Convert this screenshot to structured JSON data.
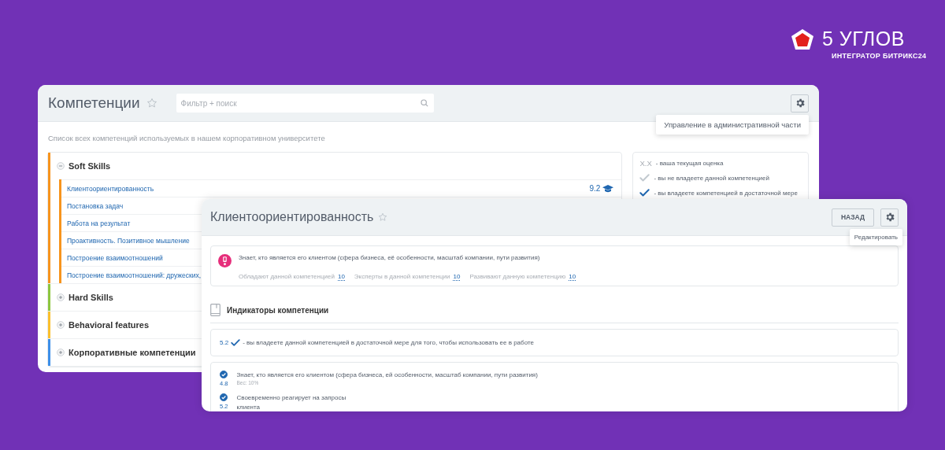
{
  "logo": {
    "name": "5 УГЛОВ",
    "tagline": "ИНТЕГРАТОР БИТРИКС24"
  },
  "catalog_window": {
    "title": "Компетенции",
    "search": {
      "placeholder": "Фильтр + поиск"
    },
    "settings_tooltip": "Управление в административной части",
    "description": "Список всех компетенций используемых в нашем корпоративном университете",
    "groups": [
      {
        "name": "Soft Skills",
        "expanded": true,
        "color": "#f7941d",
        "items": [
          {
            "name": "Клиентоориентированность",
            "score": "9.2"
          },
          {
            "name": "Постановка задач"
          },
          {
            "name": "Работа на результат"
          },
          {
            "name": "Проактивность. Позитивное мышление"
          },
          {
            "name": "Построение взаимоотношений"
          },
          {
            "name": "Построение взаимоотношений: дружеских,"
          }
        ]
      },
      {
        "name": "Hard Skills",
        "expanded": false,
        "color": "#8dc63f"
      },
      {
        "name": "Behavioral features",
        "expanded": false,
        "color": "#fbc02d"
      },
      {
        "name": "Корпоративные компетенции",
        "expanded": false,
        "color": "#3d8fe8"
      }
    ],
    "legend": [
      {
        "kind": "score",
        "symbol": "X.X",
        "text": "- ваша текущая оценка"
      },
      {
        "kind": "unchecked",
        "text": "- вы не владеете данной компетенцией"
      },
      {
        "kind": "checked",
        "text": "- вы владеете компетенцией в достаточной мере"
      }
    ]
  },
  "detail_window": {
    "title": "Клиентоориентированность",
    "back_button": "НАЗАД",
    "edit_tooltip": "Редактировать",
    "summary": {
      "text": "Знает, кто является его клиентом (сфера бизнеса, её особенности, масштаб компании, пути развития)",
      "stats": [
        {
          "label": "Обладают данной компетенцией",
          "value": "10"
        },
        {
          "label": "Эксперты в данной компетенции",
          "value": "10"
        },
        {
          "label": "Развивают данную компетенцию",
          "value": "10"
        }
      ]
    },
    "indicators_heading": "Индикаторы компетенции",
    "overall": {
      "score": "5.2",
      "text": "- вы владеете данной компетенцией в достаточной мере для того, чтобы использовать ее в работе"
    },
    "indicators": [
      {
        "score": "4.8",
        "checked": true,
        "text": "Знает, кто является его клиентом (сфера бизнеса, ей особенности, масштаб компании, пути развития)",
        "weight": "Вес: 10%"
      },
      {
        "score": "5.2",
        "checked": true,
        "text": "Своевременно реагирует на запросы\nклиента"
      }
    ]
  }
}
